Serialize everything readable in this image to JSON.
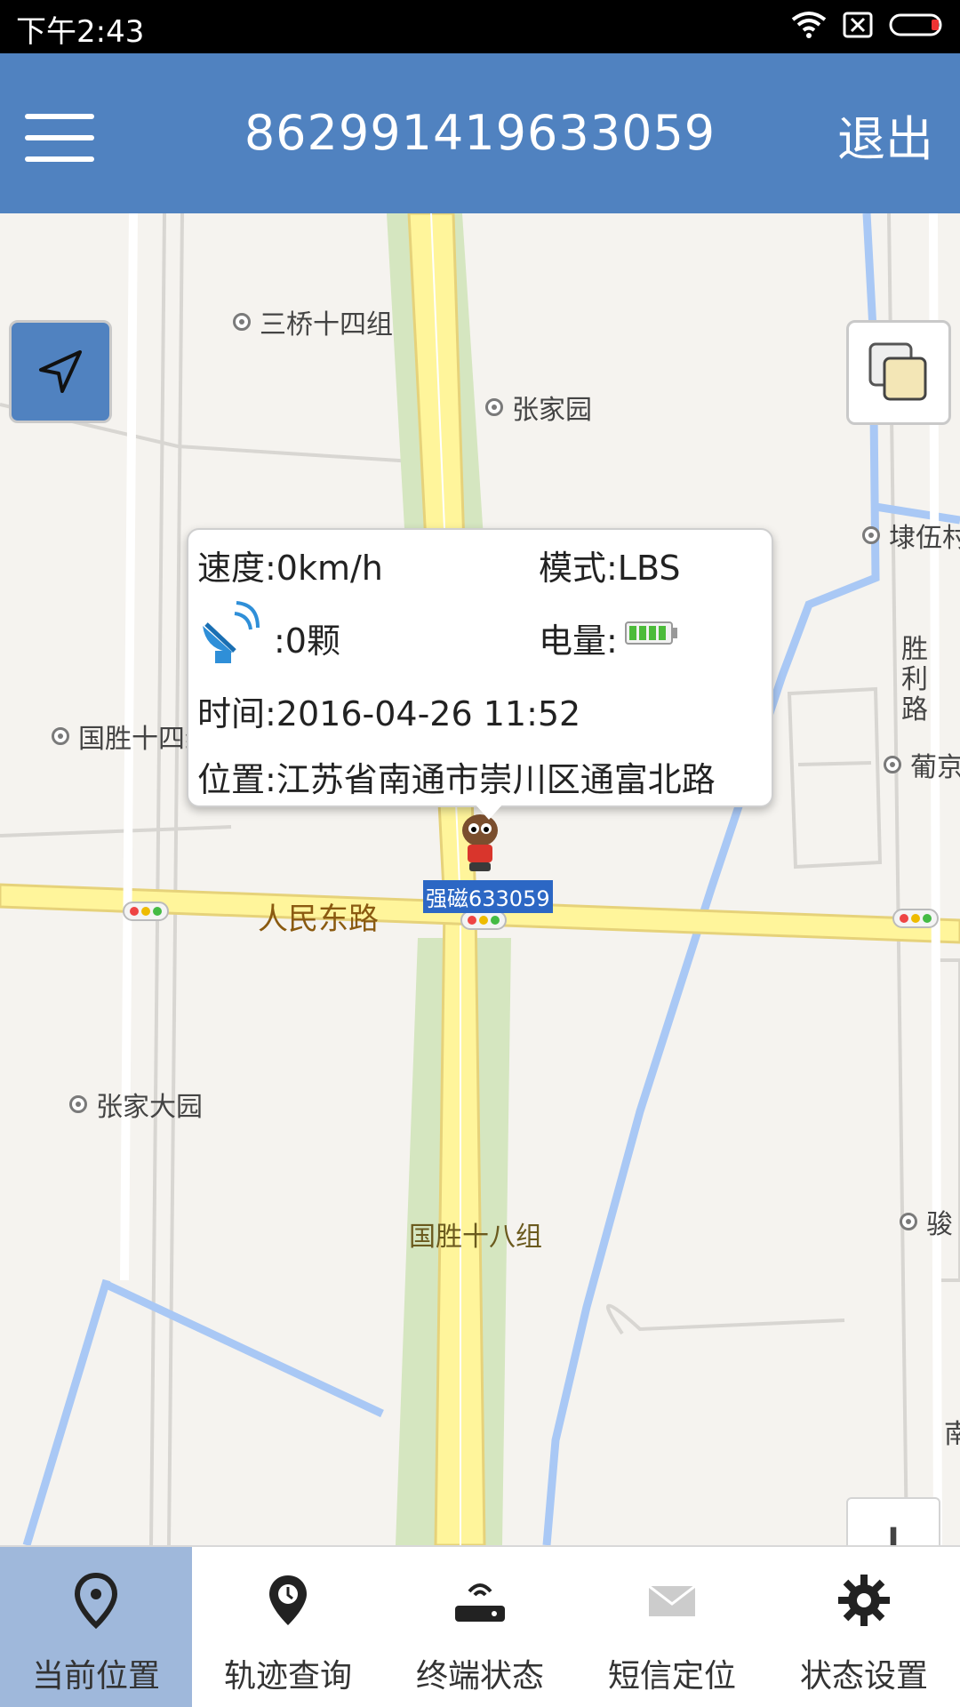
{
  "status_bar": {
    "time": "下午2:43",
    "icons": [
      "wifi-icon",
      "no-sim-icon",
      "battery-icon"
    ]
  },
  "app_bar": {
    "title": "862991419633059",
    "logout_label": "退出",
    "menu_icon": "hamburger-menu-icon"
  },
  "map": {
    "pois": [
      "三桥十四组",
      "张家园",
      "埭伍村",
      "国胜十四组",
      "葡京",
      "张家大园",
      "骏"
    ],
    "road_labels": [
      "人民东路",
      "国胜十八组",
      "胜利路",
      "南"
    ],
    "controls": {
      "location_icon": "navigation-arrow-icon",
      "layers_icon": "map-layers-icon",
      "zoom_in_label": "+",
      "zoom_out_label": "−"
    }
  },
  "info_popup": {
    "speed": "速度:0km/h",
    "mode": "模式:LBS",
    "satellites": ":0颗",
    "battery_label": "电量:",
    "time": "时间:2016-04-26 11:52",
    "location": "位置:江苏省南通市崇川区通富北路"
  },
  "marker": {
    "label": "强磁633059"
  },
  "tab_bar": {
    "tabs": [
      {
        "label": "当前位置",
        "icon": "location-pin-icon",
        "active": true
      },
      {
        "label": "轨迹查询",
        "icon": "track-pin-icon",
        "active": false
      },
      {
        "label": "终端状态",
        "icon": "terminal-device-icon",
        "active": false
      },
      {
        "label": "短信定位",
        "icon": "envelope-icon",
        "active": false
      },
      {
        "label": "状态设置",
        "icon": "gear-icon",
        "active": false
      }
    ]
  },
  "colors": {
    "app_bar": "#5082c0",
    "tab_active": "#9fb8db",
    "road_main": "#fff59b",
    "water": "#a9c8f5",
    "greenbelt": "#d5e6c0",
    "marker_label_bg": "#2c67c4"
  }
}
